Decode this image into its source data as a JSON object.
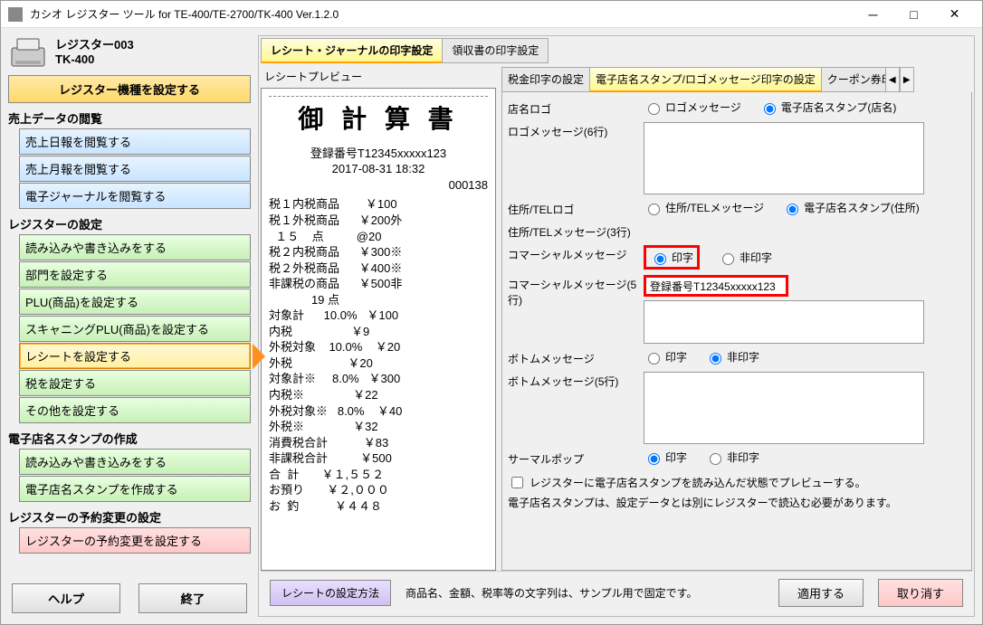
{
  "window": {
    "title": "カシオ レジスター ツール for TE-400/TE-2700/TK-400 Ver.1.2.0"
  },
  "register": {
    "name": "レジスター003",
    "model": "TK-400"
  },
  "left": {
    "set_model": "レジスター機種を設定する",
    "sec_sales": "売上データの閲覧",
    "daily": "売上日報を閲覧する",
    "monthly": "売上月報を閲覧する",
    "ej": "電子ジャーナルを閲覧する",
    "sec_settings": "レジスターの設定",
    "rw": "読み込みや書き込みをする",
    "dept": "部門を設定する",
    "plu": "PLU(商品)を設定する",
    "scanplu": "スキャニングPLU(商品)を設定する",
    "receipt": "レシートを設定する",
    "tax": "税を設定する",
    "other": "その他を設定する",
    "sec_stamp": "電子店名スタンプの作成",
    "stamp_rw": "読み込みや書き込みをする",
    "stamp_make": "電子店名スタンプを作成する",
    "sec_reserve": "レジスターの予約変更の設定",
    "reserve": "レジスターの予約変更を設定する",
    "help": "ヘルプ",
    "exit": "終了"
  },
  "tabs": {
    "t1": "レシート・ジャーナルの印字設定",
    "t2": "領収書の印字設定",
    "preview_label": "レシートプレビュー",
    "s1": "税金印字の設定",
    "s2": "電子店名スタンプ/ロゴメッセージ印字の設定",
    "s3": "クーポン券印字"
  },
  "receipt": {
    "title": "御 計 算 書",
    "reg_line": "登録番号T12345xxxxx123",
    "date": "2017-08-31 18:32",
    "seq": "000138",
    "l1": "税１内税商品        ￥100",
    "l2": "税１外税商品      ￥200外",
    "l3": "  １５    点          @20",
    "l4": "税２内税商品      ￥300※",
    "l5": "税２外税商品      ￥400※",
    "l6": "非課税の商品      ￥500非",
    "l7": "             19 点",
    "l8": "対象計      10.0%   ￥100",
    "l9": "内税                  ￥9",
    "l10": "外税対象    10.0%    ￥20",
    "l11": "外税                 ￥20",
    "l12": "対象計※     8.0%   ￥300",
    "l13": "内税※               ￥22",
    "l14": "外税対象※   8.0%    ￥40",
    "l15": "外税※               ￥32",
    "l16": "消費税合計           ￥83",
    "l17": "非課税合計          ￥500",
    "l18": "合  計       ￥１,５５２",
    "l19": "お預り       ￥２,０００",
    "l20": "お  釣           ￥４４８"
  },
  "settings": {
    "shop_logo": "店名ロゴ",
    "logo_msg_radio": "ロゴメッセージ",
    "stamp_radio": "電子店名スタンプ(店名)",
    "logo_msg_label": "ロゴメッセージ(6行)",
    "addr_logo": "住所/TELロゴ",
    "addr_msg_radio": "住所/TELメッセージ",
    "addr_stamp_radio": "電子店名スタンプ(住所)",
    "addr_msg_label": "住所/TELメッセージ(3行)",
    "commercial": "コマーシャルメッセージ",
    "print": "印字",
    "noprint": "非印字",
    "commercial5": "コマーシャルメッセージ(5行)",
    "commercial_value": "登録番号T12345xxxxx123",
    "bottom": "ボトムメッセージ",
    "bottom5": "ボトムメッセージ(5行)",
    "thermal": "サーマルポップ",
    "checkbox": "レジスターに電子店名スタンプを読み込んだ状態でプレビューする。",
    "note": "電子店名スタンプは、設定データとは別にレジスターで読込む必要があります。"
  },
  "bottom": {
    "howto": "レシートの設定方法",
    "note": "商品名、金額、税率等の文字列は、サンプル用で固定です。",
    "apply": "適用する",
    "cancel": "取り消す"
  }
}
